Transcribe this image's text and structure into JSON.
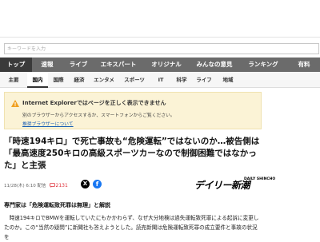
{
  "search": {
    "placeholder": "キーワードを入力"
  },
  "nav_main": [
    "トップ",
    "速報",
    "ライブ",
    "エキスパート",
    "オリジナル",
    "みんなの意見",
    "ランキング",
    "有料"
  ],
  "nav_sub": [
    "主要",
    "国内",
    "国際",
    "経済",
    "エンタメ",
    "スポーツ",
    "IT",
    "科学",
    "ライフ",
    "地域"
  ],
  "ie_banner": {
    "title": "Internet Explorerではページを正しく表示できません",
    "desc": "別のブラウザーからアクセスするか、スマートフォンからご覧ください。",
    "link": "推奨ブラウザーについて"
  },
  "article": {
    "headline": "「時速194キロ」で死亡事故も“危険運転”ではないのか…被告側は「最高速度250キロの高級スポーツカーなので制御困難ではなかった」と主張",
    "date": "11/28(木) 6:10 配信",
    "comment_count": "2131",
    "share_x": "X",
    "share_fb": "f",
    "source": "デイリー新潮",
    "source_sub": "DAILY SHINCHO",
    "subhead": "専門家は「危険運転致死罪は無理」と解説",
    "body": "　時速194キロでBMWを運転していたにもかかわらず、なぜ大分地検は過失運転致死罪による起訴に変更したのか。この“当然の疑問”に新聞社も答えようとした。読売新聞は危険運転致死罪の成立要件と事故の状況を"
  },
  "colors": {
    "nav_bg": "#6b6b6b",
    "nav_active": "#3a3a3a",
    "banner_bg": "#fbf3d6",
    "comment_red": "#e0303a",
    "fb_blue": "#1877f2",
    "link_blue": "#1a5fb4"
  }
}
